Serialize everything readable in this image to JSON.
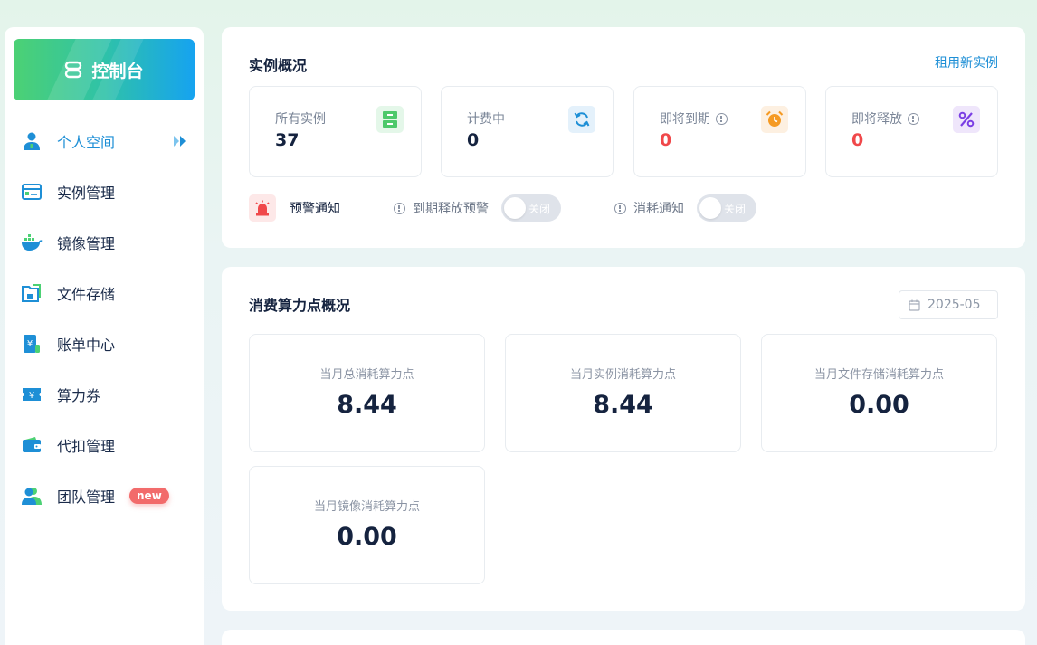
{
  "sidebar": {
    "console_label": "控制台",
    "items": [
      {
        "label": "个人空间",
        "icon": "user-icon",
        "active": true
      },
      {
        "label": "实例管理",
        "icon": "instance-icon"
      },
      {
        "label": "镜像管理",
        "icon": "docker-icon"
      },
      {
        "label": "文件存储",
        "icon": "folder-icon"
      },
      {
        "label": "账单中心",
        "icon": "bill-icon"
      },
      {
        "label": "算力券",
        "icon": "coupon-icon"
      },
      {
        "label": "代扣管理",
        "icon": "wallet-icon"
      },
      {
        "label": "团队管理",
        "icon": "team-icon",
        "badge": "new"
      }
    ]
  },
  "overview": {
    "title": "实例概况",
    "rent_link": "租用新实例",
    "cards": [
      {
        "label": "所有实例",
        "value": "37",
        "icon": "server-icon",
        "icon_color": "#4cc96a"
      },
      {
        "label": "计费中",
        "value": "0",
        "icon": "refresh-icon",
        "icon_color": "#1e8fd6"
      },
      {
        "label": "即将到期",
        "value": "0",
        "icon": "alarm-clock-icon",
        "icon_color": "#f59a23"
      },
      {
        "label": "即将释放",
        "value": "0",
        "icon": "release-icon",
        "icon_color": "#7b3fe4"
      }
    ],
    "warning": {
      "label": "预警通知",
      "expire_release_label": "到期释放预警",
      "consume_label": "消耗通知",
      "toggle_off_label": "关闭"
    }
  },
  "consumption": {
    "title": "消费算力点概况",
    "date": "2025-05",
    "stats": [
      {
        "label": "当月总消耗算力点",
        "value": "8.44"
      },
      {
        "label": "当月实例消耗算力点",
        "value": "8.44"
      },
      {
        "label": "当月文件存储消耗算力点",
        "value": "0.00"
      },
      {
        "label": "当月镜像消耗算力点",
        "value": "0.00"
      }
    ]
  }
}
